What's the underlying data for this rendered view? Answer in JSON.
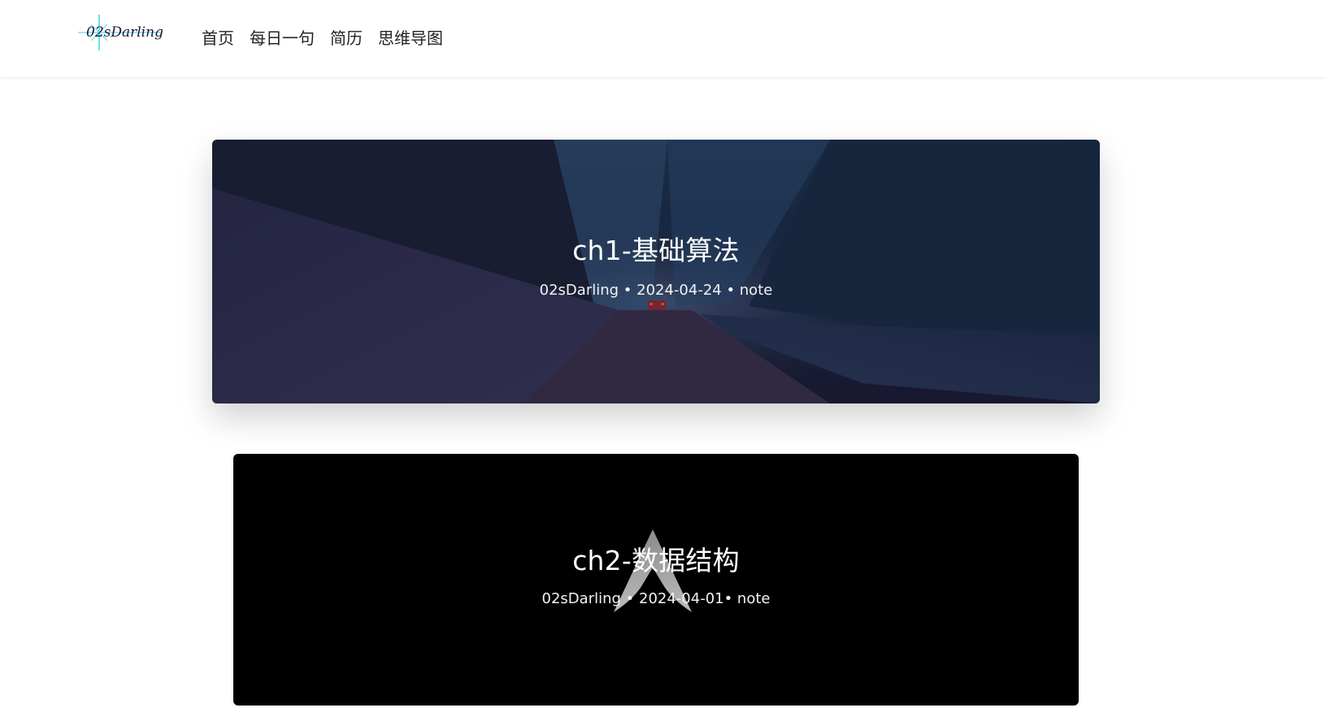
{
  "header": {
    "logo_text": "02sDarling",
    "nav": [
      {
        "label": "首页"
      },
      {
        "label": "每日一句"
      },
      {
        "label": "简历"
      },
      {
        "label": "思维导图"
      }
    ]
  },
  "posts": [
    {
      "title": "ch1-基础算法",
      "meta": "02sDarling • 2024-04-24 • note",
      "cover": "snowy-forest-road-night"
    },
    {
      "title": "ch2-数据结构",
      "meta": "02sDarling • 2024-04-01• note",
      "cover": "arch-linux-logo-black"
    }
  ],
  "colors": {
    "header_bg": "#ffffff",
    "nav_text": "#222222",
    "card2_bg": "#000000",
    "card_text": "#ffffff"
  }
}
